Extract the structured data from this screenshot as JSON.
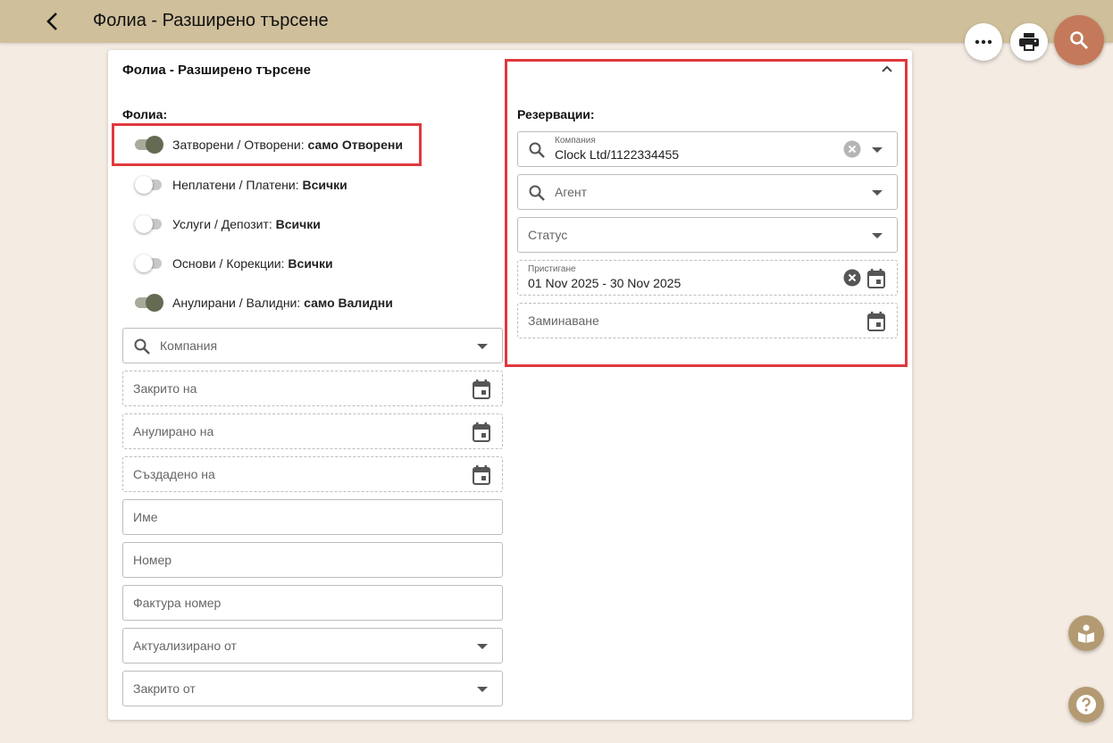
{
  "header": {
    "title": "Фолиа - Разширено търсене"
  },
  "card": {
    "title": "Фолиа - Разширено търсене",
    "folios_label": "Фолиа:",
    "toggles": [
      {
        "label": "Затворени / Отворени: ",
        "value": "само Отворени",
        "on": true
      },
      {
        "label": "Неплатени / Платени: ",
        "value": "Всички",
        "on": false
      },
      {
        "label": "Услуги / Депозит: ",
        "value": "Всички",
        "on": false
      },
      {
        "label": "Основи / Корекции: ",
        "value": "Всички",
        "on": false
      },
      {
        "label": "Анулирани / Валидни: ",
        "value": "само Валидни",
        "on": true
      }
    ],
    "left_fields": {
      "company": "Компания",
      "closed_on": "Закрито на",
      "cancelled_on": "Анулирано на",
      "created_on": "Създадено на",
      "name": "Име",
      "number": "Номер",
      "invoice_number": "Фактура номер",
      "updated_by": "Актуализирано от",
      "closed_by": "Закрито от"
    },
    "reservations": {
      "label": "Резервации:",
      "company_label": "Компания",
      "company_value": "Clock Ltd/1122334455",
      "agent": "Агент",
      "status": "Статус",
      "arrival_label": "Пристигане",
      "arrival_value": "01 Nov 2025 - 30 Nov 2025",
      "departure": "Заминаване"
    }
  },
  "icons": {
    "back": "arrow-back-icon",
    "more": "more-horizontal-icon",
    "print": "print-icon",
    "search": "search-icon",
    "guide": "guide-icon",
    "help": "help-icon"
  },
  "colors": {
    "header_bg": "#cfbf9b",
    "page_bg": "#f4ebe2",
    "accent": "#c47a5a",
    "toggle_on": "#636b53",
    "highlight": "#e0393e"
  }
}
